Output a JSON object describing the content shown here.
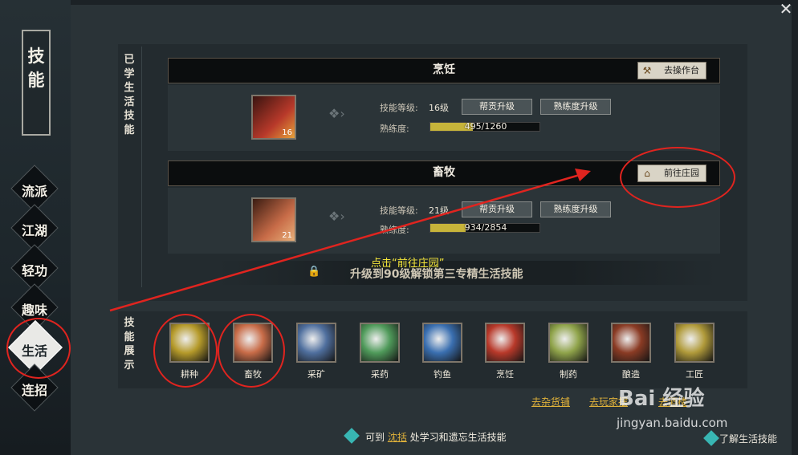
{
  "window": {
    "close_glyph": "✕"
  },
  "sidebar": {
    "title": "技能",
    "items": [
      {
        "label": "流派",
        "active": false
      },
      {
        "label": "江湖",
        "active": false
      },
      {
        "label": "轻功",
        "active": false
      },
      {
        "label": "趣味",
        "active": false
      },
      {
        "label": "生活",
        "active": true
      },
      {
        "label": "连招",
        "active": false
      }
    ]
  },
  "learned": {
    "section_title": "已学生活技能",
    "skills": [
      {
        "name": "烹饪",
        "action_label": "去操作台",
        "action_icon": "hammer-icon",
        "icon_badge": "16",
        "level_label": "技能等级:",
        "level_value": "16级",
        "btn_contribute": "帮贡升级",
        "btn_proficiency": "熟练度升级",
        "prof_label": "熟练度:",
        "prof_text": "495/1260",
        "prof_fraction": 0.393,
        "icon_color": "#b8392a"
      },
      {
        "name": "畜牧",
        "action_label": "前往庄园",
        "action_icon": "manor-icon",
        "icon_badge": "21",
        "level_label": "技能等级:",
        "level_value": "21级",
        "btn_contribute": "帮贡升级",
        "btn_proficiency": "熟练度升级",
        "prof_label": "熟练度:",
        "prof_text": "934/2854",
        "prof_fraction": 0.327,
        "icon_color": "#c86c48"
      }
    ],
    "unlock_text": "升级到90级解锁第三专精生活技能"
  },
  "annotation": "点击“前往庄园”",
  "showcase": {
    "section_title": "技能展示",
    "items": [
      {
        "label": "耕种",
        "color": "#b59a2a"
      },
      {
        "label": "畜牧",
        "color": "#c86c48"
      },
      {
        "label": "采矿",
        "color": "#4f6f9e"
      },
      {
        "label": "采药",
        "color": "#4f9a5a"
      },
      {
        "label": "钓鱼",
        "color": "#3a6fb0"
      },
      {
        "label": "烹饪",
        "color": "#b8392a"
      },
      {
        "label": "制药",
        "color": "#8fa34a"
      },
      {
        "label": "酿造",
        "color": "#8a3b24"
      },
      {
        "label": "工匠",
        "color": "#b09a3a"
      }
    ]
  },
  "links": [
    "去杂货铺",
    "去玩家摆",
    "去酒楼"
  ],
  "bottom_tip": {
    "prefix": "可到 ",
    "place": "沈括",
    "suffix": " 处学习和遗忘生活技能"
  },
  "understand_label": "了解生活技能",
  "watermark": {
    "brand": "Bai 经验",
    "url": "jingyan.baidu.com"
  },
  "colors": {
    "annotation_red": "#e0241f",
    "link_gold": "#e0b23a",
    "bar_fill": "#c7b43a"
  }
}
